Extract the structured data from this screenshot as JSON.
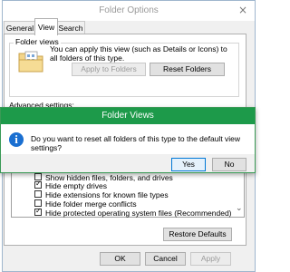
{
  "folder_options": {
    "title": "Folder Options",
    "close_glyph": "×",
    "tabs": [
      "General",
      "View",
      "Search"
    ],
    "folder_views": {
      "group_label": "Folder views",
      "description": "You can apply this view (such as Details or Icons) to all folders of this type.",
      "apply_button": "Apply to Folders",
      "reset_button": "Reset Folders"
    },
    "advanced_label": "Advanced settings:",
    "advanced_items": [
      {
        "label": "Show hidden files, folders, and drives",
        "checked": false
      },
      {
        "label": "Hide empty drives",
        "checked": true
      },
      {
        "label": "Hide extensions for known file types",
        "checked": false
      },
      {
        "label": "Hide folder merge conflicts",
        "checked": false
      },
      {
        "label": "Hide protected operating system files (Recommended)",
        "checked": true
      }
    ],
    "scroll_glyph": "⌄",
    "restore_defaults": "Restore Defaults",
    "ok": "OK",
    "cancel": "Cancel",
    "apply": "Apply"
  },
  "folder_views_dialog": {
    "title": "Folder Views",
    "icon_glyph": "i",
    "message": "Do you want to reset all folders of this type to the default view settings?",
    "yes": "Yes",
    "no": "No"
  },
  "colors": {
    "dialog_titlebar": "#1d9a4a",
    "info_icon": "#1a6fd1"
  }
}
